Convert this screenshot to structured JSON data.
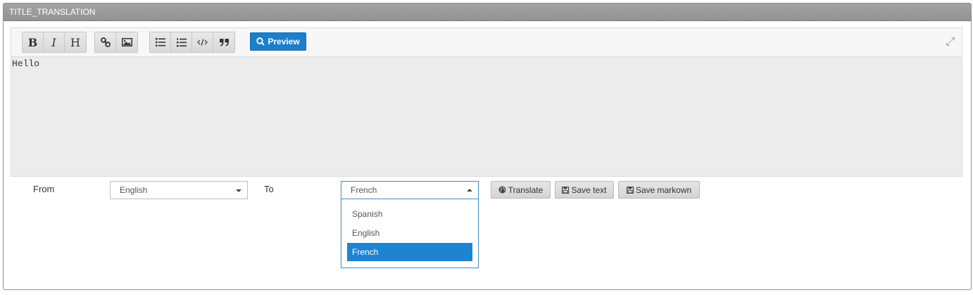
{
  "panel": {
    "title": "TITLE_TRANSLATION"
  },
  "editor": {
    "toolbar": {
      "bold_label": "B",
      "italic_label": "I",
      "heading_label": "H",
      "preview_label": "Preview"
    },
    "content": "Hello"
  },
  "form": {
    "from_label": "From",
    "from_value": "English",
    "to_label": "To",
    "to_value": "French",
    "to_options": [
      "Spanish",
      "English",
      "French"
    ],
    "translate_label": "Translate",
    "save_text_label": "Save text",
    "save_markdown_label": "Save markown"
  },
  "colors": {
    "primary": "#1b7fcc",
    "header": "#9a9a9a",
    "selected_option": "#1e84d0"
  }
}
